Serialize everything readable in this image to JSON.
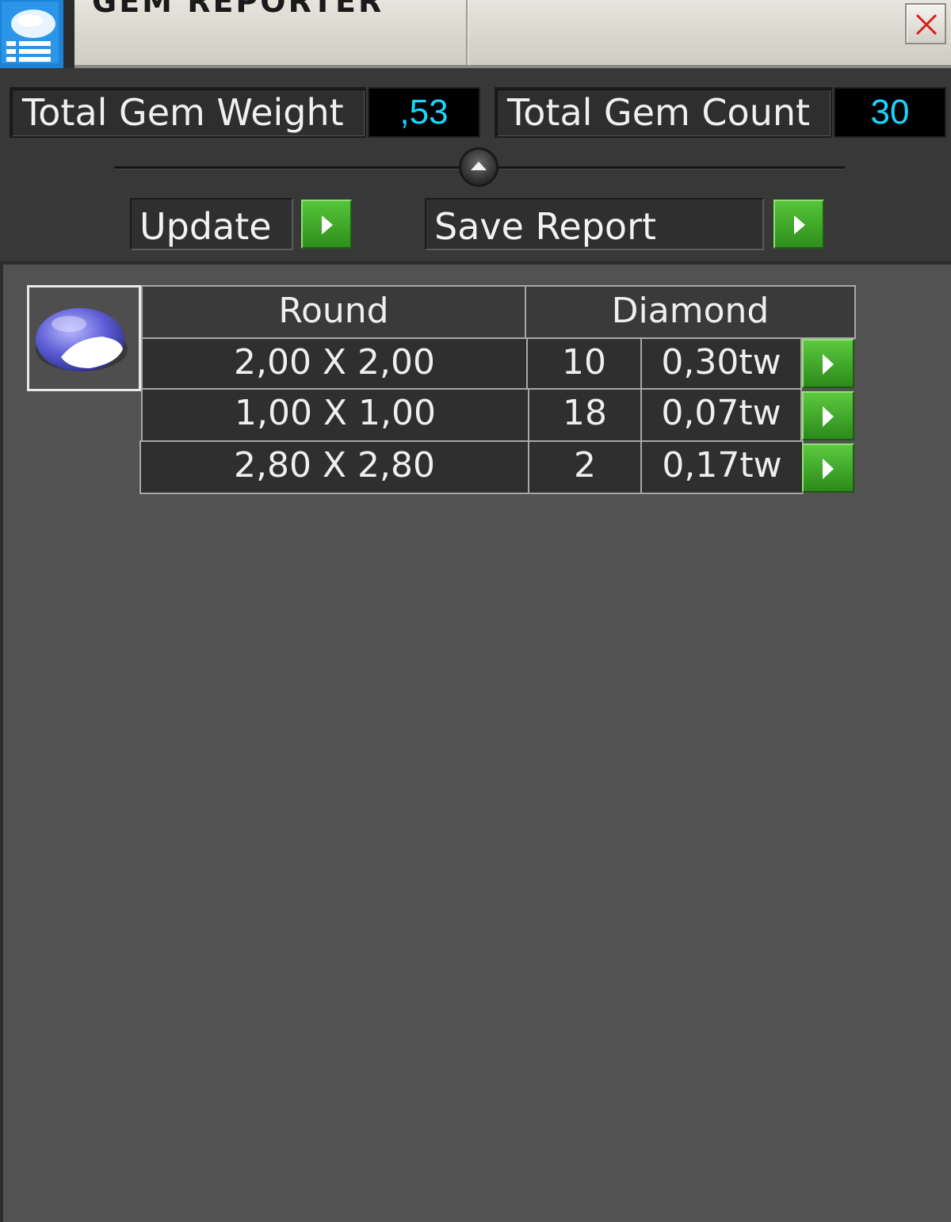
{
  "window": {
    "title": "GEM REPORTER",
    "icon": "gem-reporter-app-icon",
    "close_icon": "close-icon"
  },
  "summary": {
    "weight_label": "Total Gem Weight",
    "weight_value": ",53",
    "count_label": "Total Gem Count",
    "count_value": "30"
  },
  "actions": {
    "update_label": "Update",
    "save_label": "Save Report"
  },
  "report": {
    "gem_icon": "round-diamond-gem-icon",
    "shape": "Round",
    "material": "Diamond",
    "rows": [
      {
        "size": "2,00 X 2,00",
        "count": "10",
        "weight": "0,30tw"
      },
      {
        "size": "1,00 X 1,00",
        "count": "18",
        "weight": "0,07tw"
      },
      {
        "size": "2,80 X 2,80",
        "count": "2",
        "weight": "0,17tw"
      }
    ]
  },
  "colors": {
    "value_text": "#1ad6ff",
    "button_green": "#3fae28",
    "close_x": "#d62020",
    "panel_bg": "#3b3b3b",
    "report_bg": "#525252"
  }
}
